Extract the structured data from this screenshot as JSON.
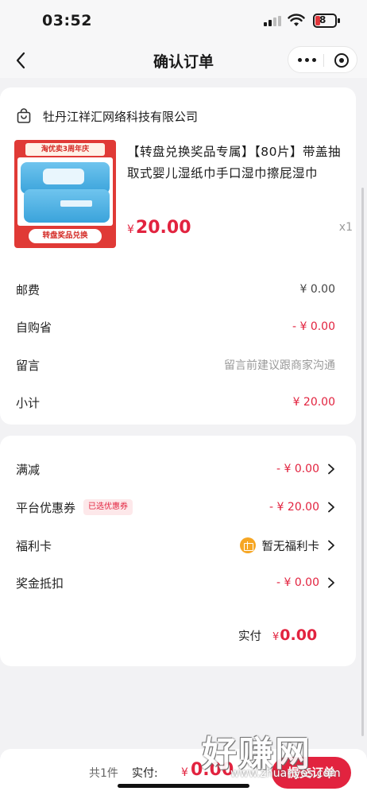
{
  "status_bar": {
    "time": "03:52",
    "battery": "8"
  },
  "nav": {
    "title": "确认订单"
  },
  "shop": {
    "name": "牡丹江祥汇网络科技有限公司"
  },
  "product": {
    "title": "【转盘兑换奖品专属】【80片】带盖抽取式婴儿湿纸巾手口湿巾擦屁湿巾纸...",
    "price_symbol": "¥",
    "price": "20.00",
    "quantity": "x1",
    "image_top_tag": "淘优卖3周年庆",
    "image_bottom_tag": "转盘奖品兑换"
  },
  "summary": {
    "postage_label": "邮费",
    "postage_value": "¥ 0.00",
    "self_save_label": "自购省",
    "self_save_value": "- ¥ 0.00",
    "message_label": "留言",
    "message_placeholder": "留言前建议跟商家沟通",
    "subtotal_label": "小计",
    "subtotal_value": "¥ 20.00"
  },
  "discounts": {
    "full_reduction_label": "满减",
    "full_reduction_value": "- ¥ 0.00",
    "platform_coupon_label": "平台优惠券",
    "platform_coupon_tag": "已选优惠券",
    "platform_coupon_value": "- ¥ 20.00",
    "welfare_card_label": "福利卡",
    "welfare_card_value": "暂无福利卡",
    "bonus_deduct_label": "奖金抵扣",
    "bonus_deduct_value": "- ¥ 0.00",
    "paid_label": "实付",
    "paid_symbol": "¥",
    "paid_value": "0.00"
  },
  "bottom_bar": {
    "count_text": "共1件",
    "actual_label": "实付:",
    "actual_symbol": "¥",
    "actual_value": "0.00",
    "submit_label": "提交订单"
  },
  "watermark": {
    "main": "好赚网",
    "sub": "www.zhuanyes.com"
  },
  "colors": {
    "accent": "#e2233f",
    "background": "#f2f2f4",
    "card": "#ffffff"
  }
}
